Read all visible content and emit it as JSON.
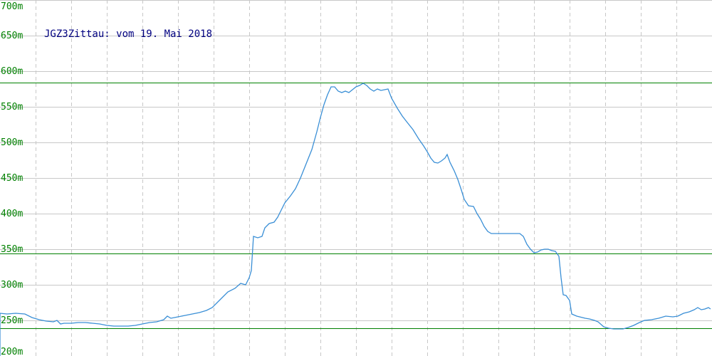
{
  "chart_data": {
    "type": "line",
    "title": "JGZ3Zittau: vom 19. Mai 2018",
    "xlabel": "",
    "ylabel": "",
    "ylim": [
      200,
      700
    ],
    "xlim": [
      0,
      1000
    ],
    "grid": true,
    "y_ticks": [
      {
        "value": 200,
        "label": "200m"
      },
      {
        "value": 250,
        "label": "250m"
      },
      {
        "value": 300,
        "label": "300m"
      },
      {
        "value": 350,
        "label": "350m"
      },
      {
        "value": 400,
        "label": "400m"
      },
      {
        "value": 450,
        "label": "450m"
      },
      {
        "value": 500,
        "label": "500m"
      },
      {
        "value": 550,
        "label": "550m"
      },
      {
        "value": 600,
        "label": "600m"
      },
      {
        "value": 650,
        "label": "650m"
      },
      {
        "value": 700,
        "label": "700m"
      }
    ],
    "x_gridlines": [
      50,
      100,
      150,
      200,
      250,
      300,
      350,
      400,
      450,
      500,
      550,
      600,
      650,
      700,
      750,
      800,
      850,
      900,
      950
    ],
    "reference_lines": [
      584,
      344,
      239
    ],
    "series": [
      {
        "color": "#3a8fd6",
        "points": [
          [
            0,
            260
          ],
          [
            10,
            259
          ],
          [
            22,
            260
          ],
          [
            35,
            259
          ],
          [
            45,
            254
          ],
          [
            55,
            251
          ],
          [
            65,
            249
          ],
          [
            75,
            248
          ],
          [
            80,
            250
          ],
          [
            85,
            245
          ],
          [
            90,
            246
          ],
          [
            100,
            246
          ],
          [
            110,
            247
          ],
          [
            120,
            247
          ],
          [
            130,
            246
          ],
          [
            140,
            245
          ],
          [
            150,
            243
          ],
          [
            160,
            242
          ],
          [
            170,
            242
          ],
          [
            180,
            242
          ],
          [
            190,
            243
          ],
          [
            200,
            245
          ],
          [
            210,
            247
          ],
          [
            220,
            248
          ],
          [
            230,
            251
          ],
          [
            235,
            256
          ],
          [
            240,
            253
          ],
          [
            250,
            255
          ],
          [
            260,
            257
          ],
          [
            270,
            259
          ],
          [
            280,
            261
          ],
          [
            290,
            264
          ],
          [
            298,
            268
          ],
          [
            305,
            275
          ],
          [
            312,
            282
          ],
          [
            320,
            290
          ],
          [
            330,
            295
          ],
          [
            338,
            302
          ],
          [
            345,
            300
          ],
          [
            350,
            310
          ],
          [
            353,
            320
          ],
          [
            356,
            368
          ],
          [
            362,
            366
          ],
          [
            368,
            368
          ],
          [
            372,
            380
          ],
          [
            378,
            386
          ],
          [
            385,
            388
          ],
          [
            390,
            395
          ],
          [
            395,
            405
          ],
          [
            400,
            415
          ],
          [
            408,
            425
          ],
          [
            415,
            435
          ],
          [
            422,
            450
          ],
          [
            430,
            470
          ],
          [
            438,
            490
          ],
          [
            445,
            515
          ],
          [
            450,
            535
          ],
          [
            455,
            553
          ],
          [
            460,
            567
          ],
          [
            465,
            578
          ],
          [
            470,
            578
          ],
          [
            475,
            572
          ],
          [
            480,
            570
          ],
          [
            485,
            572
          ],
          [
            490,
            570
          ],
          [
            495,
            574
          ],
          [
            500,
            578
          ],
          [
            505,
            580
          ],
          [
            510,
            583
          ],
          [
            515,
            580
          ],
          [
            520,
            575
          ],
          [
            525,
            572
          ],
          [
            530,
            575
          ],
          [
            535,
            573
          ],
          [
            540,
            574
          ],
          [
            545,
            575
          ],
          [
            550,
            562
          ],
          [
            558,
            548
          ],
          [
            565,
            537
          ],
          [
            572,
            528
          ],
          [
            580,
            518
          ],
          [
            588,
            505
          ],
          [
            595,
            495
          ],
          [
            600,
            487
          ],
          [
            605,
            478
          ],
          [
            610,
            472
          ],
          [
            615,
            471
          ],
          [
            620,
            474
          ],
          [
            625,
            478
          ],
          [
            628,
            483
          ],
          [
            632,
            472
          ],
          [
            638,
            460
          ],
          [
            643,
            448
          ],
          [
            648,
            433
          ],
          [
            652,
            420
          ],
          [
            658,
            411
          ],
          [
            665,
            410
          ],
          [
            670,
            400
          ],
          [
            675,
            392
          ],
          [
            680,
            382
          ],
          [
            685,
            375
          ],
          [
            690,
            372
          ],
          [
            700,
            372
          ],
          [
            710,
            372
          ],
          [
            720,
            372
          ],
          [
            730,
            372
          ],
          [
            735,
            368
          ],
          [
            740,
            357
          ],
          [
            745,
            350
          ],
          [
            750,
            345
          ],
          [
            755,
            346
          ],
          [
            760,
            349
          ],
          [
            765,
            350
          ],
          [
            770,
            350
          ],
          [
            775,
            348
          ],
          [
            780,
            347
          ],
          [
            785,
            340
          ],
          [
            788,
            310
          ],
          [
            791,
            286
          ],
          [
            795,
            285
          ],
          [
            800,
            278
          ],
          [
            803,
            259
          ],
          [
            810,
            256
          ],
          [
            818,
            254
          ],
          [
            822,
            253
          ],
          [
            828,
            252
          ],
          [
            835,
            250
          ],
          [
            840,
            248
          ],
          [
            848,
            241
          ],
          [
            855,
            239
          ],
          [
            862,
            238
          ],
          [
            868,
            238
          ],
          [
            875,
            238
          ],
          [
            882,
            240
          ],
          [
            890,
            243
          ],
          [
            898,
            247
          ],
          [
            905,
            250
          ],
          [
            915,
            251
          ],
          [
            925,
            253
          ],
          [
            935,
            256
          ],
          [
            945,
            255
          ],
          [
            952,
            256
          ],
          [
            960,
            260
          ],
          [
            968,
            262
          ],
          [
            975,
            265
          ],
          [
            980,
            268
          ],
          [
            985,
            265
          ],
          [
            990,
            266
          ],
          [
            995,
            268
          ],
          [
            998,
            266
          ]
        ]
      }
    ]
  }
}
